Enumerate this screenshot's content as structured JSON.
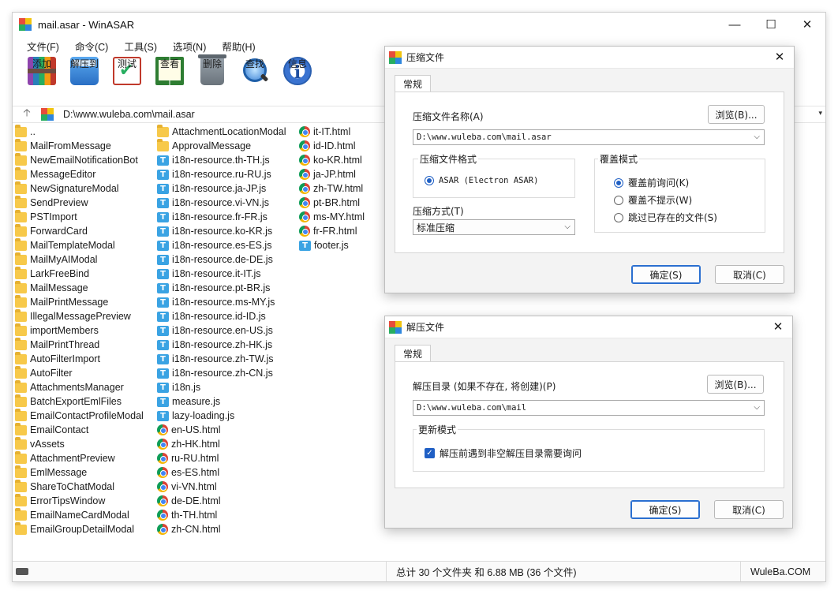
{
  "window": {
    "title": "mail.asar - WinASAR",
    "controls": {
      "minimize": "—",
      "maximize": "☐",
      "close": "✕"
    }
  },
  "menu": [
    "文件(F)",
    "命令(C)",
    "工具(S)",
    "选项(N)",
    "帮助(H)"
  ],
  "toolbar": [
    {
      "label": "添加",
      "icon": "archive-books-icon"
    },
    {
      "label": "解压到",
      "icon": "folder-extract-icon"
    },
    {
      "label": "测试",
      "icon": "checklist-icon"
    },
    {
      "label": "查看",
      "icon": "book-icon"
    },
    {
      "label": "删除",
      "icon": "trash-icon"
    },
    {
      "label": "查找",
      "icon": "magnifier-icon"
    },
    {
      "label": "信息",
      "icon": "info-icon"
    }
  ],
  "address": {
    "path": "D:\\www.wuleba.com\\mail.asar",
    "up": "🡡",
    "dropdown": "▾"
  },
  "files": {
    "col1": [
      {
        "name": "..",
        "type": "folder"
      },
      {
        "name": "MailFromMessage",
        "type": "folder"
      },
      {
        "name": "NewEmailNotificationBot",
        "type": "folder"
      },
      {
        "name": "MessageEditor",
        "type": "folder"
      },
      {
        "name": "NewSignatureModal",
        "type": "folder"
      },
      {
        "name": "SendPreview",
        "type": "folder"
      },
      {
        "name": "PSTImport",
        "type": "folder"
      },
      {
        "name": "ForwardCard",
        "type": "folder"
      },
      {
        "name": "MailTemplateModal",
        "type": "folder"
      },
      {
        "name": "MailMyAIModal",
        "type": "folder"
      },
      {
        "name": "LarkFreeBind",
        "type": "folder"
      },
      {
        "name": "MailMessage",
        "type": "folder"
      },
      {
        "name": "MailPrintMessage",
        "type": "folder"
      },
      {
        "name": "IllegalMessagePreview",
        "type": "folder"
      },
      {
        "name": "importMembers",
        "type": "folder"
      },
      {
        "name": "MailPrintThread",
        "type": "folder"
      },
      {
        "name": "AutoFilterImport",
        "type": "folder"
      },
      {
        "name": "AutoFilter",
        "type": "folder"
      },
      {
        "name": "AttachmentsManager",
        "type": "folder"
      },
      {
        "name": "BatchExportEmlFiles",
        "type": "folder"
      },
      {
        "name": "EmailContactProfileModal",
        "type": "folder"
      },
      {
        "name": "EmailContact",
        "type": "folder"
      },
      {
        "name": "vAssets",
        "type": "folder"
      },
      {
        "name": "AttachmentPreview",
        "type": "folder"
      },
      {
        "name": "EmlMessage",
        "type": "folder"
      },
      {
        "name": "ShareToChatModal",
        "type": "folder"
      },
      {
        "name": "ErrorTipsWindow",
        "type": "folder"
      },
      {
        "name": "EmailNameCardModal",
        "type": "folder"
      },
      {
        "name": "EmailGroupDetailModal",
        "type": "folder"
      }
    ],
    "col2": [
      {
        "name": "AttachmentLocationModal",
        "type": "folder"
      },
      {
        "name": "ApprovalMessage",
        "type": "folder"
      },
      {
        "name": "i18n-resource.th-TH.js",
        "type": "js"
      },
      {
        "name": "i18n-resource.ru-RU.js",
        "type": "js"
      },
      {
        "name": "i18n-resource.ja-JP.js",
        "type": "js"
      },
      {
        "name": "i18n-resource.vi-VN.js",
        "type": "js"
      },
      {
        "name": "i18n-resource.fr-FR.js",
        "type": "js"
      },
      {
        "name": "i18n-resource.ko-KR.js",
        "type": "js"
      },
      {
        "name": "i18n-resource.es-ES.js",
        "type": "js"
      },
      {
        "name": "i18n-resource.de-DE.js",
        "type": "js"
      },
      {
        "name": "i18n-resource.it-IT.js",
        "type": "js"
      },
      {
        "name": "i18n-resource.pt-BR.js",
        "type": "js"
      },
      {
        "name": "i18n-resource.ms-MY.js",
        "type": "js"
      },
      {
        "name": "i18n-resource.id-ID.js",
        "type": "js"
      },
      {
        "name": "i18n-resource.en-US.js",
        "type": "js"
      },
      {
        "name": "i18n-resource.zh-HK.js",
        "type": "js"
      },
      {
        "name": "i18n-resource.zh-TW.js",
        "type": "js"
      },
      {
        "name": "i18n-resource.zh-CN.js",
        "type": "js"
      },
      {
        "name": "i18n.js",
        "type": "js"
      },
      {
        "name": "measure.js",
        "type": "js"
      },
      {
        "name": "lazy-loading.js",
        "type": "js"
      },
      {
        "name": "en-US.html",
        "type": "html"
      },
      {
        "name": "zh-HK.html",
        "type": "html"
      },
      {
        "name": "ru-RU.html",
        "type": "html"
      },
      {
        "name": "es-ES.html",
        "type": "html"
      },
      {
        "name": "vi-VN.html",
        "type": "html"
      },
      {
        "name": "de-DE.html",
        "type": "html"
      },
      {
        "name": "th-TH.html",
        "type": "html"
      },
      {
        "name": "zh-CN.html",
        "type": "html"
      }
    ],
    "col3": [
      {
        "name": "it-IT.html",
        "type": "html"
      },
      {
        "name": "id-ID.html",
        "type": "html"
      },
      {
        "name": "ko-KR.html",
        "type": "html"
      },
      {
        "name": "ja-JP.html",
        "type": "html"
      },
      {
        "name": "zh-TW.html",
        "type": "html"
      },
      {
        "name": "pt-BR.html",
        "type": "html"
      },
      {
        "name": "ms-MY.html",
        "type": "html"
      },
      {
        "name": "fr-FR.html",
        "type": "html"
      },
      {
        "name": "footer.js",
        "type": "js"
      }
    ]
  },
  "status": {
    "summary": "总计 30 个文件夹 和 6.88 MB (36 个文件)",
    "brand": "WuleBa.COM"
  },
  "compress_dialog": {
    "title": "压缩文件",
    "close": "✕",
    "tab": "常规",
    "name_label": "压缩文件名称(A)",
    "browse": "浏览(B)...",
    "path": "D:\\www.wuleba.com\\mail.asar",
    "format_group": "压缩文件格式",
    "format_option": "ASAR (Electron ASAR)",
    "method_label": "压缩方式(T)",
    "method_value": "标准压缩",
    "overwrite_group": "覆盖模式",
    "overwrite_options": [
      "覆盖前询问(K)",
      "覆盖不提示(W)",
      "跳过已存在的文件(S)"
    ],
    "ok": "确定(S)",
    "cancel": "取消(C)"
  },
  "extract_dialog": {
    "title": "解压文件",
    "close": "✕",
    "tab": "常规",
    "dir_label": "解压目录 (如果不存在, 将创建)(P)",
    "browse": "浏览(B)...",
    "path": "D:\\www.wuleba.com\\mail",
    "update_group": "更新模式",
    "ask_check": "解压前遇到非空解压目录需要询问",
    "ok": "确定(S)",
    "cancel": "取消(C)"
  }
}
